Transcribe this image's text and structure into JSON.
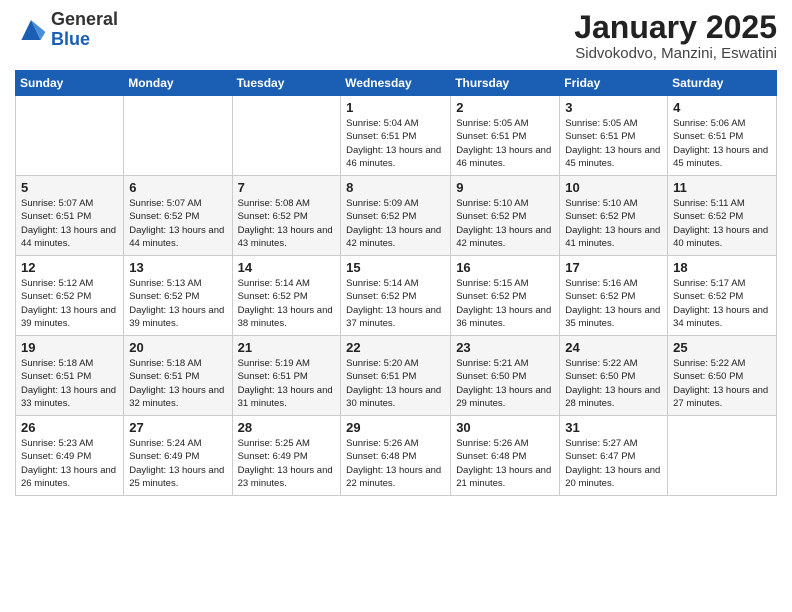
{
  "header": {
    "logo_general": "General",
    "logo_blue": "Blue",
    "month_title": "January 2025",
    "location": "Sidvokodvo, Manzini, Eswatini"
  },
  "weekdays": [
    "Sunday",
    "Monday",
    "Tuesday",
    "Wednesday",
    "Thursday",
    "Friday",
    "Saturday"
  ],
  "weeks": [
    [
      {
        "day": "",
        "info": ""
      },
      {
        "day": "",
        "info": ""
      },
      {
        "day": "",
        "info": ""
      },
      {
        "day": "1",
        "info": "Sunrise: 5:04 AM\nSunset: 6:51 PM\nDaylight: 13 hours\nand 46 minutes."
      },
      {
        "day": "2",
        "info": "Sunrise: 5:05 AM\nSunset: 6:51 PM\nDaylight: 13 hours\nand 46 minutes."
      },
      {
        "day": "3",
        "info": "Sunrise: 5:05 AM\nSunset: 6:51 PM\nDaylight: 13 hours\nand 45 minutes."
      },
      {
        "day": "4",
        "info": "Sunrise: 5:06 AM\nSunset: 6:51 PM\nDaylight: 13 hours\nand 45 minutes."
      }
    ],
    [
      {
        "day": "5",
        "info": "Sunrise: 5:07 AM\nSunset: 6:51 PM\nDaylight: 13 hours\nand 44 minutes."
      },
      {
        "day": "6",
        "info": "Sunrise: 5:07 AM\nSunset: 6:52 PM\nDaylight: 13 hours\nand 44 minutes."
      },
      {
        "day": "7",
        "info": "Sunrise: 5:08 AM\nSunset: 6:52 PM\nDaylight: 13 hours\nand 43 minutes."
      },
      {
        "day": "8",
        "info": "Sunrise: 5:09 AM\nSunset: 6:52 PM\nDaylight: 13 hours\nand 42 minutes."
      },
      {
        "day": "9",
        "info": "Sunrise: 5:10 AM\nSunset: 6:52 PM\nDaylight: 13 hours\nand 42 minutes."
      },
      {
        "day": "10",
        "info": "Sunrise: 5:10 AM\nSunset: 6:52 PM\nDaylight: 13 hours\nand 41 minutes."
      },
      {
        "day": "11",
        "info": "Sunrise: 5:11 AM\nSunset: 6:52 PM\nDaylight: 13 hours\nand 40 minutes."
      }
    ],
    [
      {
        "day": "12",
        "info": "Sunrise: 5:12 AM\nSunset: 6:52 PM\nDaylight: 13 hours\nand 39 minutes."
      },
      {
        "day": "13",
        "info": "Sunrise: 5:13 AM\nSunset: 6:52 PM\nDaylight: 13 hours\nand 39 minutes."
      },
      {
        "day": "14",
        "info": "Sunrise: 5:14 AM\nSunset: 6:52 PM\nDaylight: 13 hours\nand 38 minutes."
      },
      {
        "day": "15",
        "info": "Sunrise: 5:14 AM\nSunset: 6:52 PM\nDaylight: 13 hours\nand 37 minutes."
      },
      {
        "day": "16",
        "info": "Sunrise: 5:15 AM\nSunset: 6:52 PM\nDaylight: 13 hours\nand 36 minutes."
      },
      {
        "day": "17",
        "info": "Sunrise: 5:16 AM\nSunset: 6:52 PM\nDaylight: 13 hours\nand 35 minutes."
      },
      {
        "day": "18",
        "info": "Sunrise: 5:17 AM\nSunset: 6:52 PM\nDaylight: 13 hours\nand 34 minutes."
      }
    ],
    [
      {
        "day": "19",
        "info": "Sunrise: 5:18 AM\nSunset: 6:51 PM\nDaylight: 13 hours\nand 33 minutes."
      },
      {
        "day": "20",
        "info": "Sunrise: 5:18 AM\nSunset: 6:51 PM\nDaylight: 13 hours\nand 32 minutes."
      },
      {
        "day": "21",
        "info": "Sunrise: 5:19 AM\nSunset: 6:51 PM\nDaylight: 13 hours\nand 31 minutes."
      },
      {
        "day": "22",
        "info": "Sunrise: 5:20 AM\nSunset: 6:51 PM\nDaylight: 13 hours\nand 30 minutes."
      },
      {
        "day": "23",
        "info": "Sunrise: 5:21 AM\nSunset: 6:50 PM\nDaylight: 13 hours\nand 29 minutes."
      },
      {
        "day": "24",
        "info": "Sunrise: 5:22 AM\nSunset: 6:50 PM\nDaylight: 13 hours\nand 28 minutes."
      },
      {
        "day": "25",
        "info": "Sunrise: 5:22 AM\nSunset: 6:50 PM\nDaylight: 13 hours\nand 27 minutes."
      }
    ],
    [
      {
        "day": "26",
        "info": "Sunrise: 5:23 AM\nSunset: 6:49 PM\nDaylight: 13 hours\nand 26 minutes."
      },
      {
        "day": "27",
        "info": "Sunrise: 5:24 AM\nSunset: 6:49 PM\nDaylight: 13 hours\nand 25 minutes."
      },
      {
        "day": "28",
        "info": "Sunrise: 5:25 AM\nSunset: 6:49 PM\nDaylight: 13 hours\nand 23 minutes."
      },
      {
        "day": "29",
        "info": "Sunrise: 5:26 AM\nSunset: 6:48 PM\nDaylight: 13 hours\nand 22 minutes."
      },
      {
        "day": "30",
        "info": "Sunrise: 5:26 AM\nSunset: 6:48 PM\nDaylight: 13 hours\nand 21 minutes."
      },
      {
        "day": "31",
        "info": "Sunrise: 5:27 AM\nSunset: 6:47 PM\nDaylight: 13 hours\nand 20 minutes."
      },
      {
        "day": "",
        "info": ""
      }
    ]
  ]
}
